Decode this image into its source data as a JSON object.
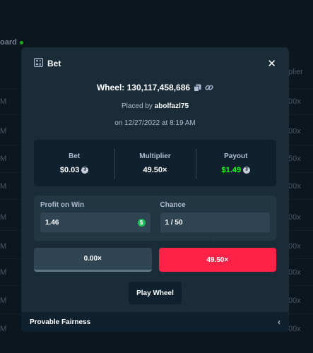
{
  "background": {
    "tab_label": "oard",
    "header_right": "plier",
    "rows": [
      {
        "left": "M",
        "right": "00x"
      },
      {
        "left": "M",
        "right": "00x"
      },
      {
        "left": "M",
        "right": "50x"
      },
      {
        "left": "M",
        "right": "00x"
      },
      {
        "left": "M",
        "right": "00x"
      },
      {
        "left": "M",
        "right": "00x"
      },
      {
        "left": "M",
        "right": "00x"
      },
      {
        "left": "M",
        "right": "00x"
      },
      {
        "left": "M",
        "right": "00x"
      }
    ]
  },
  "modal": {
    "title": "Bet",
    "game_title": "Wheel: 130,117,458,686",
    "placed_by_prefix": "Placed by",
    "username": "abolfazl75",
    "date": "on 12/27/2022 at 8:19 AM",
    "stats": {
      "bet_label": "Bet",
      "bet_value": "$0.03",
      "multiplier_label": "Multiplier",
      "multiplier_value": "49.50×",
      "payout_label": "Payout",
      "payout_value": "$1.49"
    },
    "inputs": {
      "profit_label": "Profit on Win",
      "profit_value": "1.46",
      "chance_label": "Chance",
      "chance_value": "1 / 50"
    },
    "segments": {
      "grey": "0.00×",
      "red": "49.50×"
    },
    "play_button": "Play Wheel",
    "footer": "Provable Fairness",
    "colors": {
      "accent_red": "#fe2247",
      "payout_green": "#1fff20",
      "modal_bg": "#1a2c38"
    }
  }
}
